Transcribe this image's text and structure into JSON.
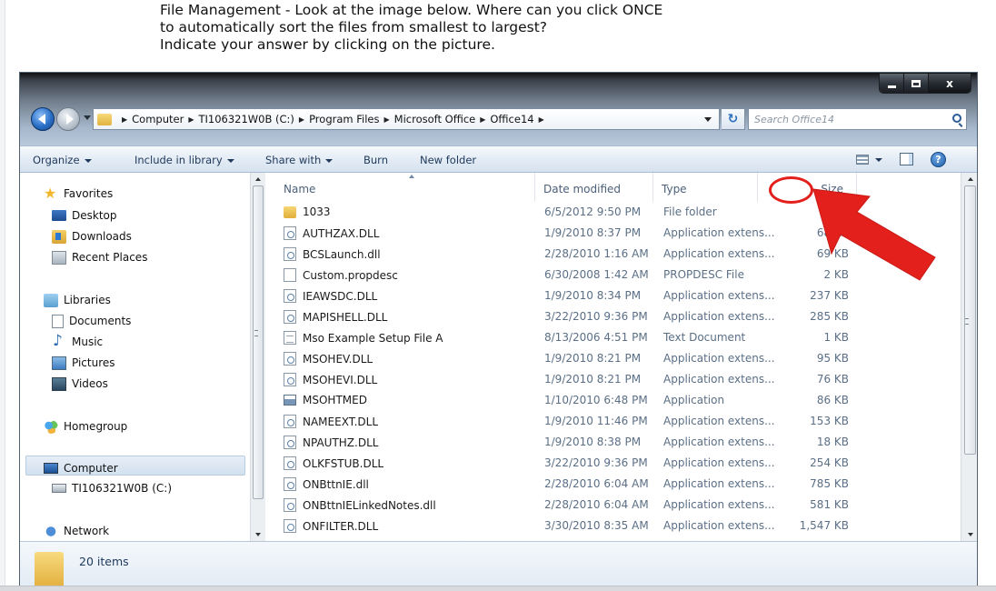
{
  "question": {
    "line1": "File Management - Look at the image below. Where can you click ONCE",
    "line2": "to automatically sort the files from smallest to largest?",
    "line3": "Indicate your answer by clicking on the picture."
  },
  "window": {
    "caption_buttons": {
      "close": "x"
    }
  },
  "address": {
    "crumbs": [
      "Computer",
      "TI106321W0B (C:)",
      "Program Files",
      "Microsoft Office",
      "Office14"
    ]
  },
  "search": {
    "placeholder": "Search Office14"
  },
  "toolbar": {
    "organize": "Organize",
    "include_in_library": "Include in library",
    "share_with": "Share with",
    "burn": "Burn",
    "new_folder": "New folder",
    "help": "?"
  },
  "navpane": {
    "favorites": "Favorites",
    "desktop": "Desktop",
    "downloads": "Downloads",
    "recent_places": "Recent Places",
    "libraries": "Libraries",
    "documents": "Documents",
    "music": "Music",
    "pictures": "Pictures",
    "videos": "Videos",
    "homegroup": "Homegroup",
    "computer": "Computer",
    "drive": "TI106321W0B (C:)",
    "network": "Network"
  },
  "columns": {
    "name": "Name",
    "date": "Date modified",
    "type": "Type",
    "size": "Size"
  },
  "files": [
    {
      "name": "1033",
      "date": "6/5/2012 9:50 PM",
      "type": "File folder",
      "size": "",
      "icon": "folder-icon"
    },
    {
      "name": "AUTHZAX.DLL",
      "date": "1/9/2010 8:37 PM",
      "type": "Application extens...",
      "size": "68 KB",
      "icon": "dll-icon"
    },
    {
      "name": "BCSLaunch.dll",
      "date": "2/28/2010 1:16 AM",
      "type": "Application extens...",
      "size": "69 KB",
      "icon": "dll-icon"
    },
    {
      "name": "Custom.propdesc",
      "date": "6/30/2008 1:42 AM",
      "type": "PROPDESC File",
      "size": "2 KB",
      "icon": "file-icon"
    },
    {
      "name": "IEAWSDC.DLL",
      "date": "1/9/2010 8:34 PM",
      "type": "Application extens...",
      "size": "237 KB",
      "icon": "dll-icon"
    },
    {
      "name": "MAPISHELL.DLL",
      "date": "3/22/2010 9:36 PM",
      "type": "Application extens...",
      "size": "285 KB",
      "icon": "dll-icon"
    },
    {
      "name": "Mso Example Setup File A",
      "date": "8/13/2006 4:51 PM",
      "type": "Text Document",
      "size": "1 KB",
      "icon": "text-file-icon"
    },
    {
      "name": "MSOHEV.DLL",
      "date": "1/9/2010 8:21 PM",
      "type": "Application extens...",
      "size": "95 KB",
      "icon": "dll-icon"
    },
    {
      "name": "MSOHEVI.DLL",
      "date": "1/9/2010 8:21 PM",
      "type": "Application extens...",
      "size": "76 KB",
      "icon": "dll-icon"
    },
    {
      "name": "MSOHTMED",
      "date": "1/10/2010 6:48 PM",
      "type": "Application",
      "size": "86 KB",
      "icon": "application-icon"
    },
    {
      "name": "NAMEEXT.DLL",
      "date": "1/9/2010 11:46 PM",
      "type": "Application extens...",
      "size": "153 KB",
      "icon": "dll-icon"
    },
    {
      "name": "NPAUTHZ.DLL",
      "date": "1/9/2010 8:38 PM",
      "type": "Application extens...",
      "size": "18 KB",
      "icon": "dll-icon"
    },
    {
      "name": "OLKFSTUB.DLL",
      "date": "3/22/2010 9:36 PM",
      "type": "Application extens...",
      "size": "254 KB",
      "icon": "dll-icon"
    },
    {
      "name": "ONBttnIE.dll",
      "date": "2/28/2010 6:04 AM",
      "type": "Application extens...",
      "size": "785 KB",
      "icon": "dll-icon"
    },
    {
      "name": "ONBttnIELinkedNotes.dll",
      "date": "2/28/2010 6:04 AM",
      "type": "Application extens...",
      "size": "581 KB",
      "icon": "dll-icon"
    },
    {
      "name": "ONFILTER.DLL",
      "date": "3/30/2010 8:35 AM",
      "type": "Application extens...",
      "size": "1,547 KB",
      "icon": "dll-icon"
    }
  ],
  "details": {
    "item_count": "20 items"
  },
  "colors": {
    "highlight": "#e3201b",
    "nav_text": "#1e395b"
  }
}
